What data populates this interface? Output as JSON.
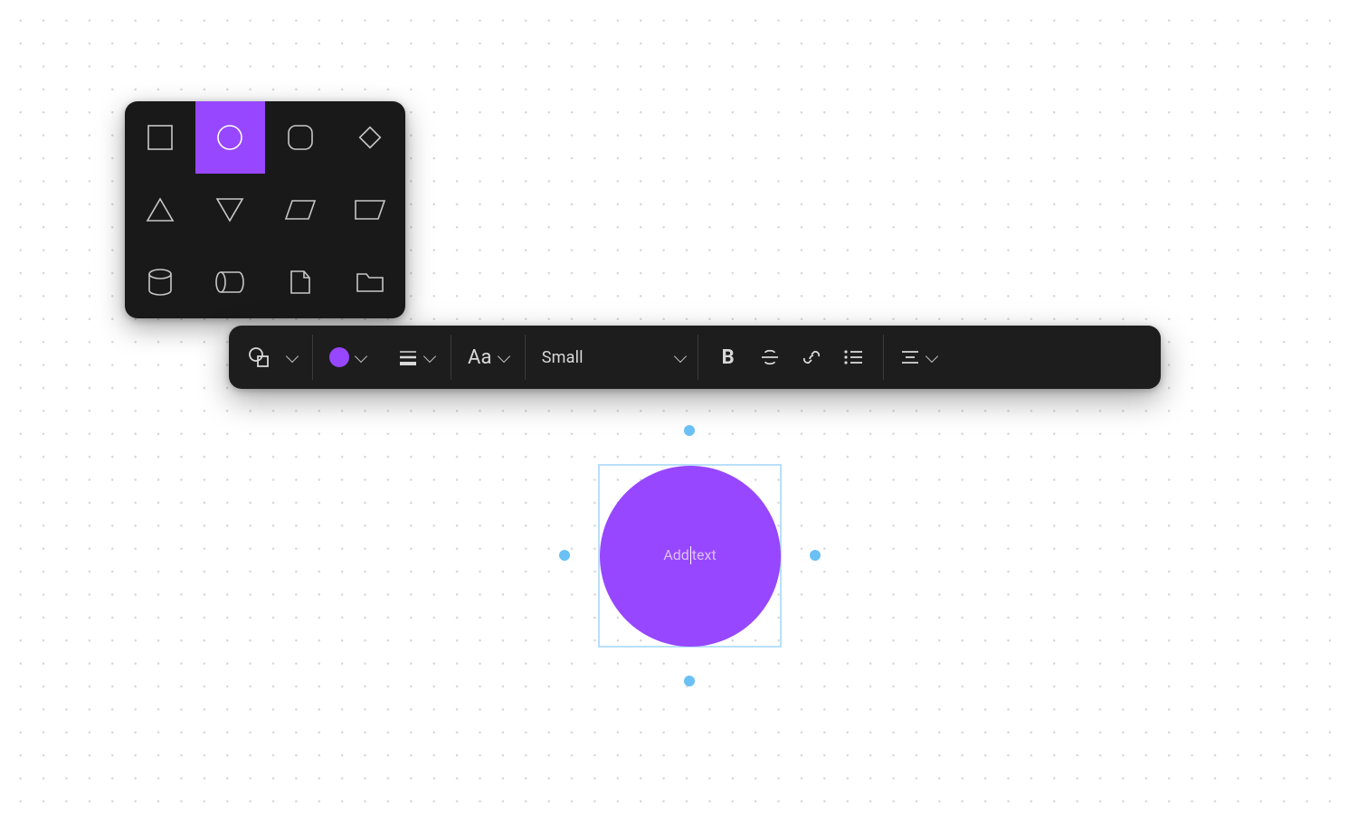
{
  "colors": {
    "accent": "#9747ff",
    "panel": "#191919",
    "toolbar": "#1d1d1d",
    "selection": "#b9dffb",
    "handle": "#6ac0f4"
  },
  "shape_picker": {
    "selected_index": 1,
    "shapes": [
      "square",
      "circle",
      "rounded-square",
      "diamond",
      "triangle",
      "triangle-down",
      "parallelogram",
      "trapezoid",
      "cylinder",
      "cylinder-horizontal",
      "file",
      "folder"
    ]
  },
  "toolbar": {
    "shape_tool_name": "shape",
    "color_hex": "#9747ff",
    "line_weight_name": "line-weight",
    "font_label": "Aa",
    "size_label": "Small",
    "bold_glyph": "B",
    "strike_name": "strikethrough",
    "link_name": "link",
    "list_name": "bullet-list",
    "align_name": "align-center"
  },
  "canvas": {
    "selected_shape": "circle",
    "fill": "#9747ff",
    "placeholder_before": "Add",
    "placeholder_after": "text"
  }
}
